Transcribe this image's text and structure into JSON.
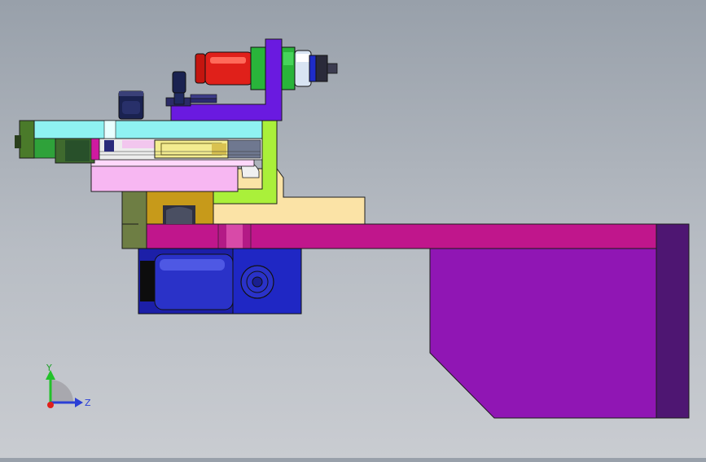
{
  "viewport": {
    "background_top": "#98a0aa",
    "background_bottom": "#c9ccd1"
  },
  "triad": {
    "y_label": "Y",
    "z_label": "Z",
    "y_color": "#22c12a",
    "z_color": "#2b3fd6",
    "x_color": "#e0201a"
  },
  "model": {
    "colors": {
      "cyan_plate": "#8ff2f2",
      "magenta_rail": "#c0168c",
      "purple_block": "#9016b4",
      "purple_dark": "#4e1672",
      "lime_bracket": "#aaf03a",
      "tan_block": "#fbe3a6",
      "pink_plate": "#f7b7f2",
      "violet_bracket": "#6a1ae0",
      "blue_motor": "#1c1fa8",
      "red_cylinder": "#e0201a",
      "green_nut": "#29b43a",
      "olive_block": "#6e7e44",
      "gold_slide": "#c79a1a",
      "yellow_insert": "#f3ec8f"
    }
  }
}
